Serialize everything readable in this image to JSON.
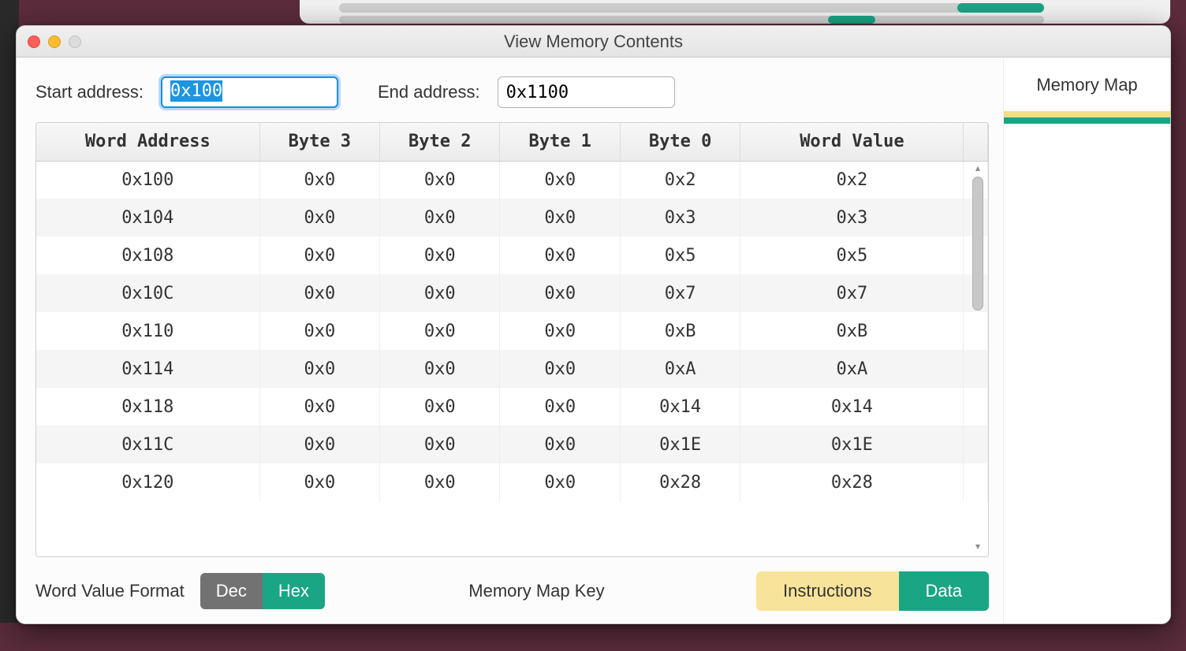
{
  "window": {
    "title": "View Memory Contents"
  },
  "inputs": {
    "start_label": "Start address:",
    "start_value": "0x100",
    "end_label": "End address:",
    "end_value": "0x1100"
  },
  "table": {
    "headers": {
      "word_address": "Word Address",
      "byte3": "Byte 3",
      "byte2": "Byte 2",
      "byte1": "Byte 1",
      "byte0": "Byte 0",
      "word_value": "Word Value"
    },
    "rows": [
      {
        "addr": "0x100",
        "b3": "0x0",
        "b2": "0x0",
        "b1": "0x0",
        "b0": "0x2",
        "wv": "0x2"
      },
      {
        "addr": "0x104",
        "b3": "0x0",
        "b2": "0x0",
        "b1": "0x0",
        "b0": "0x3",
        "wv": "0x3"
      },
      {
        "addr": "0x108",
        "b3": "0x0",
        "b2": "0x0",
        "b1": "0x0",
        "b0": "0x5",
        "wv": "0x5"
      },
      {
        "addr": "0x10C",
        "b3": "0x0",
        "b2": "0x0",
        "b1": "0x0",
        "b0": "0x7",
        "wv": "0x7"
      },
      {
        "addr": "0x110",
        "b3": "0x0",
        "b2": "0x0",
        "b1": "0x0",
        "b0": "0xB",
        "wv": "0xB"
      },
      {
        "addr": "0x114",
        "b3": "0x0",
        "b2": "0x0",
        "b1": "0x0",
        "b0": "0xA",
        "wv": "0xA"
      },
      {
        "addr": "0x118",
        "b3": "0x0",
        "b2": "0x0",
        "b1": "0x0",
        "b0": "0x14",
        "wv": "0x14"
      },
      {
        "addr": "0x11C",
        "b3": "0x0",
        "b2": "0x0",
        "b1": "0x0",
        "b0": "0x1E",
        "wv": "0x1E"
      },
      {
        "addr": "0x120",
        "b3": "0x0",
        "b2": "0x0",
        "b1": "0x0",
        "b0": "0x28",
        "wv": "0x28"
      }
    ]
  },
  "footer": {
    "format_label": "Word Value Format",
    "dec": "Dec",
    "hex": "Hex",
    "map_key_label": "Memory Map Key",
    "instructions": "Instructions",
    "data": "Data"
  },
  "sidebar": {
    "heading": "Memory Map"
  },
  "colors": {
    "teal": "#1aa584",
    "yellow": "#f8e39a"
  }
}
